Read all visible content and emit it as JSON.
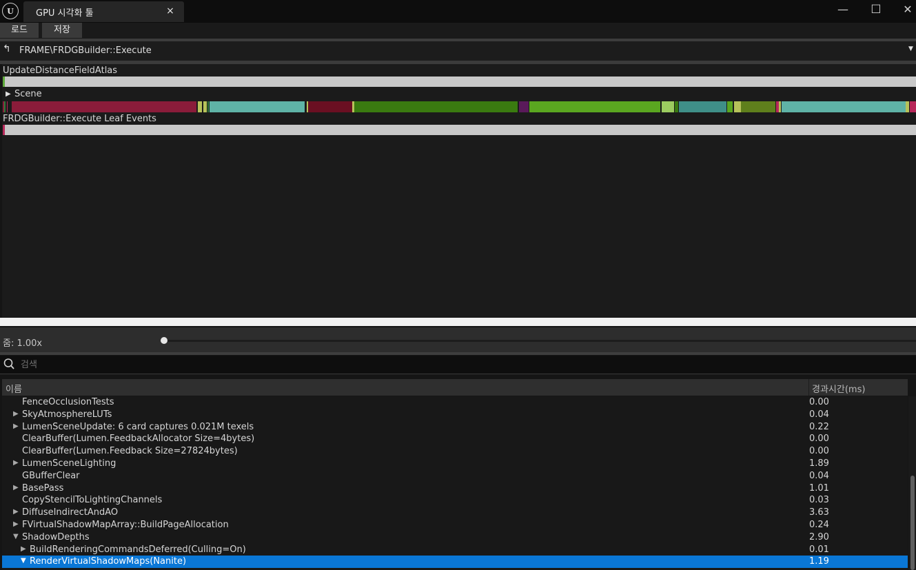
{
  "window": {
    "logo_text": "U",
    "tab_title": "GPU 시각화 툴",
    "tab_close": "×",
    "minimize": "—",
    "maximize": "☐",
    "close": "✕"
  },
  "toolbar": {
    "load_label": "로드",
    "save_label": "저장"
  },
  "breadcrumb": {
    "path": "FRAME\\FRDGBuilder::Execute",
    "up_icon": "↰",
    "dropdown_icon": "▼"
  },
  "timeline": {
    "track1_label": "UpdateDistanceFieldAtlas",
    "track2_label": "Scene",
    "track3_label": "FRDGBuilder::Execute Leaf Events",
    "expand_icon": "▶"
  },
  "zoom": {
    "label": "줌: 1.00x",
    "slider_value": 0.0
  },
  "search": {
    "placeholder": "검색",
    "value": ""
  },
  "table": {
    "columns": {
      "name": "이름",
      "time": "경과시간(ms)"
    },
    "rows": [
      {
        "name": "FenceOcclusionTests",
        "time": "0.00",
        "arrow": "",
        "depth": 0,
        "selected": false
      },
      {
        "name": "SkyAtmosphereLUTs",
        "time": "0.04",
        "arrow": "▶",
        "depth": 0,
        "selected": false
      },
      {
        "name": "LumenSceneUpdate: 6 card captures 0.021M texels",
        "time": "0.22",
        "arrow": "▶",
        "depth": 0,
        "selected": false
      },
      {
        "name": "ClearBuffer(Lumen.FeedbackAllocator Size=4bytes)",
        "time": "0.00",
        "arrow": "",
        "depth": 0,
        "selected": false
      },
      {
        "name": "ClearBuffer(Lumen.Feedback Size=27824bytes)",
        "time": "0.00",
        "arrow": "",
        "depth": 0,
        "selected": false
      },
      {
        "name": "LumenSceneLighting",
        "time": "1.89",
        "arrow": "▶",
        "depth": 0,
        "selected": false
      },
      {
        "name": "GBufferClear",
        "time": "0.04",
        "arrow": "",
        "depth": 0,
        "selected": false
      },
      {
        "name": "BasePass",
        "time": "1.01",
        "arrow": "▶",
        "depth": 0,
        "selected": false
      },
      {
        "name": "CopyStencilToLightingChannels",
        "time": "0.03",
        "arrow": "",
        "depth": 0,
        "selected": false
      },
      {
        "name": "DiffuseIndirectAndAO",
        "time": "3.63",
        "arrow": "▶",
        "depth": 0,
        "selected": false
      },
      {
        "name": "FVirtualShadowMapArray::BuildPageAllocation",
        "time": "0.24",
        "arrow": "▶",
        "depth": 0,
        "selected": false
      },
      {
        "name": "ShadowDepths",
        "time": "2.90",
        "arrow": "▼",
        "depth": 0,
        "selected": false
      },
      {
        "name": "BuildRenderingCommandsDeferred(Culling=On)",
        "time": "0.01",
        "arrow": "▶",
        "depth": 1,
        "selected": false
      },
      {
        "name": "RenderVirtualShadowMaps(Nanite)",
        "time": "1.19",
        "arrow": "▼",
        "depth": 1,
        "selected": true
      }
    ]
  },
  "colors": {
    "accent_selection": "#0a77d6",
    "scene_segments": [
      "#2f7a3a",
      "#8a1c3a",
      "#b7c25a",
      "#2e8a7a",
      "#5fb3a6",
      "#6a0f22",
      "#3a7a10",
      "#5a1a5a",
      "#5aa620",
      "#9ccc60",
      "#3f8f88",
      "#5f7f1c",
      "#b8285a"
    ]
  }
}
